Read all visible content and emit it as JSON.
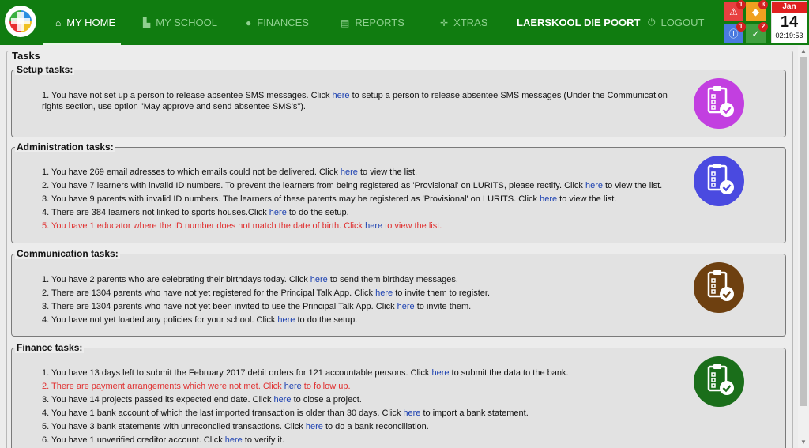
{
  "nav": {
    "items": [
      {
        "label": "MY HOME",
        "icon": "home-icon"
      },
      {
        "label": "MY SCHOOL",
        "icon": "school-icon"
      },
      {
        "label": "FINANCES",
        "icon": "money-bag-icon"
      },
      {
        "label": "REPORTS",
        "icon": "report-icon"
      },
      {
        "label": "XTRAS",
        "icon": "crosshair-icon"
      },
      {
        "label": "LAERSKOOL DIE POORT"
      },
      {
        "label": "LOGOUT",
        "icon": "power-icon"
      }
    ]
  },
  "alerts": {
    "warning_count": "1",
    "info_orange_count": "3",
    "info_blue_count": "1",
    "check_count": "2"
  },
  "calendar": {
    "month": "Jan",
    "day": "14",
    "time": "02:19:53"
  },
  "tasks": {
    "title": "Tasks",
    "sections": [
      {
        "title": "Setup tasks:",
        "color": "#c23fe0",
        "items": [
          {
            "pre": "1. You have not set up a person to release absentee SMS messages. Click ",
            "link": "here",
            "post": " to setup a person to release absentee SMS messages (Under the Communication rights section, use option \"May approve and send absentee SMS's\").",
            "red": false
          }
        ]
      },
      {
        "title": "Administration tasks:",
        "color": "#4a4ae0",
        "items": [
          {
            "pre": "1. You have 269 email adresses to which emails could not be delivered. Click ",
            "link": "here",
            "post": " to view the list.",
            "red": false
          },
          {
            "pre": "2. You have 7 learners with invalid ID numbers. To prevent the learners from being registered as 'Provisional' on LURITS, please rectify. Click ",
            "link": "here",
            "post": " to view the list.",
            "red": false
          },
          {
            "pre": "3. You have 9 parents with invalid ID numbers. The learners of these parents may be registered as 'Provisional' on LURITS. Click ",
            "link": "here",
            "post": " to view the list.",
            "red": false
          },
          {
            "pre": "4. There are 384 learners not linked to sports houses.Click ",
            "link": "here",
            "post": " to do the setup.",
            "red": false
          },
          {
            "pre": "5. You have 1 educator where the ID number does not match the date of birth. Click ",
            "link": "here",
            "post": " to view the list.",
            "red": true
          }
        ]
      },
      {
        "title": "Communication tasks:",
        "color": "#6e4010",
        "items": [
          {
            "pre": "1. You have 2 parents who are celebrating their birthdays today. Click ",
            "link": "here",
            "post": " to send them birthday messages.",
            "red": false
          },
          {
            "pre": "2. There are 1304 parents who have not yet registered for the Principal Talk App. Click ",
            "link": "here",
            "post": " to invite them to register.",
            "red": false
          },
          {
            "pre": "3. There are 1304 parents who have not yet been invited to use the Principal Talk App. Click ",
            "link": "here",
            "post": " to invite them.",
            "red": false
          },
          {
            "pre": "4. You have not yet loaded any policies for your school. Click ",
            "link": "here",
            "post": " to do the setup.",
            "red": false
          }
        ]
      },
      {
        "title": "Finance tasks:",
        "color": "#1a6e1a",
        "items": [
          {
            "pre": "1. You have 13 days left to submit the February 2017 debit orders for 121 accountable persons. Click ",
            "link": "here",
            "post": " to submit the data to the bank.",
            "red": false
          },
          {
            "pre": "2. There are payment arrangements which were not met. Click ",
            "link": "here",
            "post": " to follow up.",
            "red": true
          },
          {
            "pre": "3. You have 14 projects passed its expected end date. Click ",
            "link": "here",
            "post": " to close a project.",
            "red": false
          },
          {
            "pre": "4. You have 1 bank account of which the last imported transaction is older than 30 days. Click ",
            "link": "here",
            "post": " to import a bank statement.",
            "red": false
          },
          {
            "pre": "5. You have 3 bank statements with unreconciled transactions. Click ",
            "link": "here",
            "post": " to do a bank reconciliation.",
            "red": false
          },
          {
            "pre": "6. You have 1 unverified creditor account. Click ",
            "link": "here",
            "post": " to verify it.",
            "red": false
          }
        ]
      }
    ]
  }
}
